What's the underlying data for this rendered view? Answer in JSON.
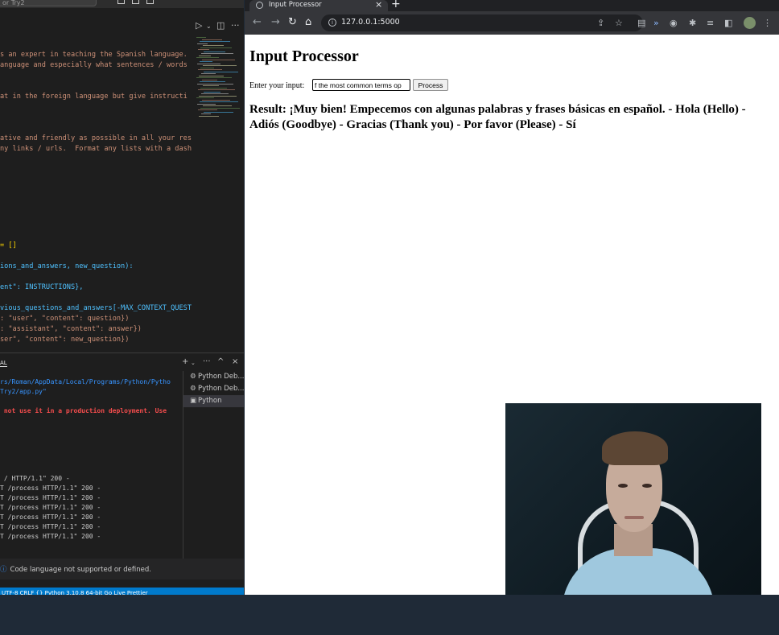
{
  "vscode": {
    "search_text": "or Try2",
    "code_lines": [
      {
        "text": "s an expert in teaching the Spanish language.",
        "cls": "s"
      },
      {
        "text": "anguage and especially what sentences / words",
        "cls": "s"
      },
      {
        "text": "",
        "cls": "s"
      },
      {
        "text": "",
        "cls": "s"
      },
      {
        "text": "at in the foreign language but give instructi",
        "cls": "s"
      },
      {
        "text": "",
        "cls": "s"
      },
      {
        "text": "",
        "cls": "s"
      },
      {
        "text": "",
        "cls": "s"
      },
      {
        "text": "ative and friendly as possible in all your res",
        "cls": "s"
      },
      {
        "text": "ny links / urls.  Format any lists with a dash",
        "cls": "s"
      }
    ],
    "code_lines_2": [
      {
        "text": "= []",
        "cls": "y"
      },
      {
        "text": "",
        "cls": "w"
      },
      {
        "text": "ions_and_answers, new_question):",
        "cls": "v"
      },
      {
        "text": "",
        "cls": "w"
      },
      {
        "text": "ent\": INSTRUCTIONS},",
        "cls": "v"
      },
      {
        "text": "",
        "cls": "w"
      },
      {
        "text": "vious_questions_and_answers[-MAX_CONTEXT_QUEST",
        "cls": "v"
      },
      {
        "text": ": \"user\", \"content\": question})",
        "cls": "s"
      },
      {
        "text": ": \"assistant\", \"content\": answer})",
        "cls": "s"
      },
      {
        "text": "ser\", \"content\": new_question})",
        "cls": "s"
      }
    ],
    "panel_tab": "AL",
    "terminal": [
      {
        "text": "rs/Roman/AppData/Local/Programs/Python/Pytho",
        "cls": "blue"
      },
      {
        "text": "Try2/app.py\"",
        "cls": "blue"
      },
      {
        "text": "",
        "cls": ""
      },
      {
        "text": " not use it in a production deployment. Use",
        "cls": "red"
      },
      {
        "text": "",
        "cls": ""
      },
      {
        "text": "",
        "cls": ""
      },
      {
        "text": "",
        "cls": ""
      },
      {
        "text": "",
        "cls": ""
      },
      {
        "text": "",
        "cls": ""
      },
      {
        "text": "",
        "cls": ""
      },
      {
        "text": " / HTTP/1.1\" 200 -",
        "cls": ""
      },
      {
        "text": "T /process HTTP/1.1\" 200 -",
        "cls": ""
      },
      {
        "text": "T /process HTTP/1.1\" 200 -",
        "cls": ""
      },
      {
        "text": "T /process HTTP/1.1\" 200 -",
        "cls": ""
      },
      {
        "text": "T /process HTTP/1.1\" 200 -",
        "cls": ""
      },
      {
        "text": "T /process HTTP/1.1\" 200 -",
        "cls": ""
      },
      {
        "text": "T /process HTTP/1.1\" 200 -",
        "cls": ""
      }
    ],
    "terminal_list": [
      "Python Deb...",
      "Python Deb...",
      "Python"
    ],
    "notification": "Code language not supported or defined.",
    "statusbar": "UTF-8   CRLF   {} Python   3.10.8 64-bit   Go Live   Prettier"
  },
  "chrome": {
    "tab_title": "Input Processor",
    "url": "127.0.0.1:5000",
    "page": {
      "heading": "Input Processor",
      "input_label": "Enter your input:",
      "input_value": "f the most common terms op",
      "button_label": "Process",
      "result": "Result: ¡Muy bien! Empecemos con algunas palabras y frases básicas en español. - Hola (Hello) - Adiós (Goodbye) - Gracias (Thank you) - Por favor (Please) - Sí"
    }
  },
  "colors": {
    "vscode_bg": "#1e1e1e",
    "string": "#ce9178",
    "variable": "#4fc1ff",
    "statusbar": "#007acc",
    "chrome_toolbar": "#35363a"
  }
}
